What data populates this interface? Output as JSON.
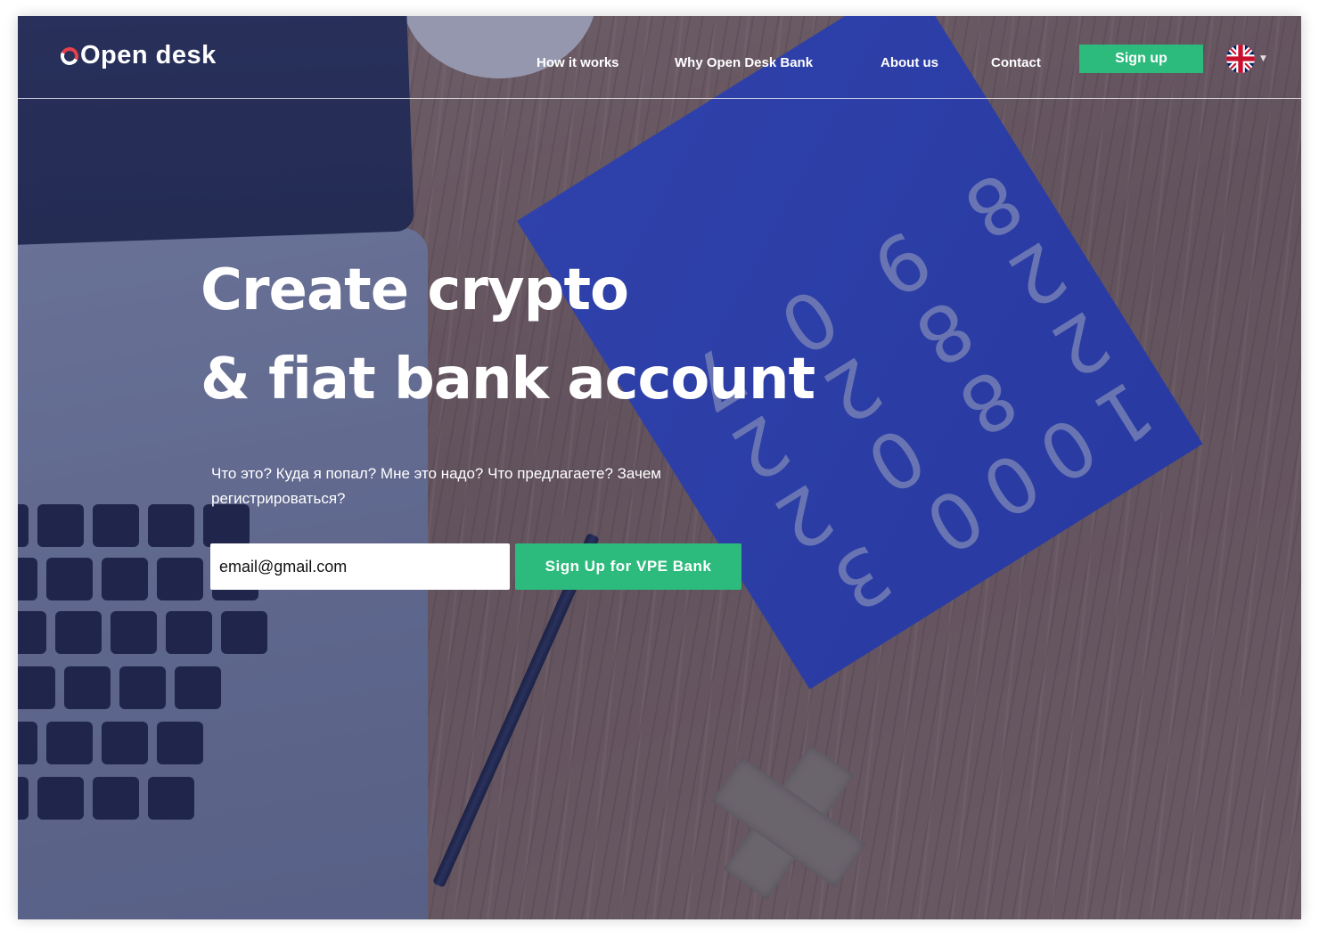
{
  "brand": {
    "name": "Open desk",
    "accent_color": "#e8404b"
  },
  "nav": {
    "items": [
      {
        "label": "How it works"
      },
      {
        "label": "Why Open Desk Bank"
      },
      {
        "label": "About us"
      },
      {
        "label": "Contact"
      }
    ],
    "signup_label": "Sign up",
    "language": {
      "icon": "uk-flag-icon",
      "caret_icon": "caret-down-icon"
    }
  },
  "hero": {
    "title_line1": "Create crypto",
    "title_line2": "& fiat bank account",
    "subtitle": "Что это? Куда я попал? Мне это надо? Что предлагаете? Зачем регистрироваться?",
    "email_value": "email@gmail.com",
    "cta_label": "Sign Up for VPE Bank",
    "cta_color": "#2dbb7d"
  }
}
